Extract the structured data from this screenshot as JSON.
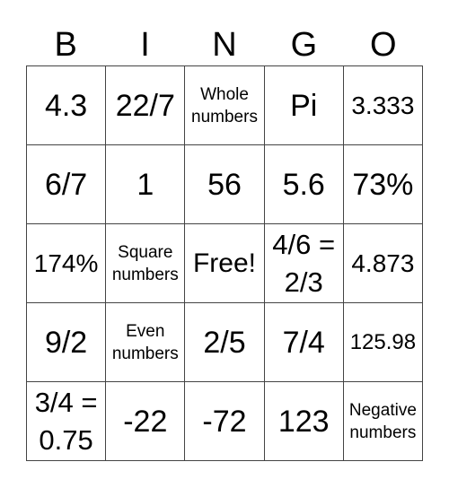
{
  "header": [
    "B",
    "I",
    "N",
    "G",
    "O"
  ],
  "cells": [
    [
      {
        "text": "4.3",
        "size": "s-xl"
      },
      {
        "text": "22/7",
        "size": "s-xl"
      },
      {
        "text": "Whole\nnumbers",
        "size": "s-xs"
      },
      {
        "text": "Pi",
        "size": "s-xl"
      },
      {
        "text": "3.333",
        "size": "s-md"
      }
    ],
    [
      {
        "text": "6/7",
        "size": "s-xl"
      },
      {
        "text": "1",
        "size": "s-xl"
      },
      {
        "text": "56",
        "size": "s-xl"
      },
      {
        "text": "5.6",
        "size": "s-xl"
      },
      {
        "text": "73%",
        "size": "s-xl"
      }
    ],
    [
      {
        "text": "174%",
        "size": "s-md"
      },
      {
        "text": "Square\nnumbers",
        "size": "s-xs"
      },
      {
        "text": "Free!",
        "size": "s-lg"
      },
      {
        "text": "4/6 =\n2/3",
        "size": "s-mdl"
      },
      {
        "text": "4.873",
        "size": "s-md"
      }
    ],
    [
      {
        "text": "9/2",
        "size": "s-xl"
      },
      {
        "text": "Even\nnumbers",
        "size": "s-xs"
      },
      {
        "text": "2/5",
        "size": "s-xl"
      },
      {
        "text": "7/4",
        "size": "s-xl"
      },
      {
        "text": "125.98",
        "size": "s-sm"
      }
    ],
    [
      {
        "text": "3/4 =\n0.75",
        "size": "s-mdl"
      },
      {
        "text": "-22",
        "size": "s-xl"
      },
      {
        "text": "-72",
        "size": "s-xl"
      },
      {
        "text": "123",
        "size": "s-xl"
      },
      {
        "text": "Negative\nnumbers",
        "size": "s-xs"
      }
    ]
  ]
}
